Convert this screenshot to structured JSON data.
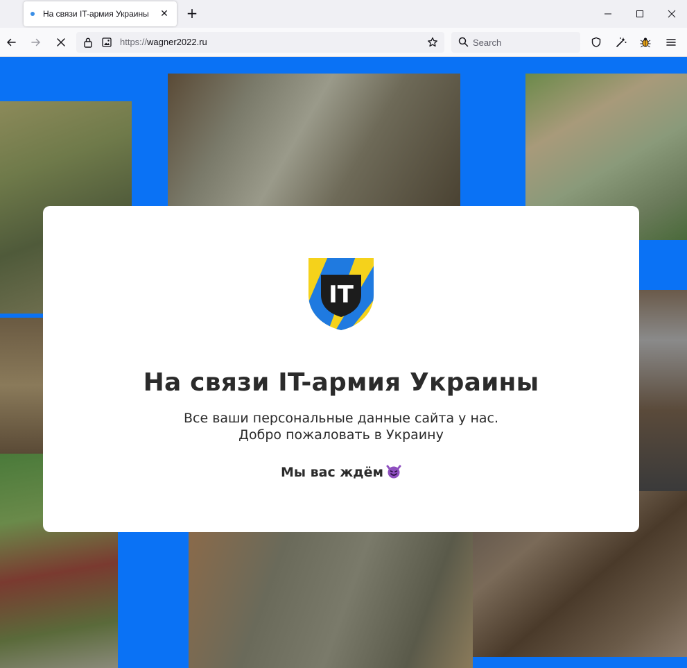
{
  "browser": {
    "tab_title": "На связи IT-армия Украины",
    "tab_close": "✕",
    "new_tab": "+",
    "url_scheme": "https://",
    "url_host": "wagner2022.ru",
    "search_placeholder": "Search"
  },
  "page": {
    "logo_text": "IT",
    "heading": "На связи IT-армия Украины",
    "subtext_line1": "Все ваши персональные данные сайта у нас.",
    "subtext_line2": "Добро пожаловать в Украину",
    "tagline": "Мы вас ждём"
  },
  "icons": {
    "back": "arrow-left-icon",
    "forward": "arrow-right-icon",
    "stop": "close-icon",
    "lock": "lock-icon",
    "page_info": "image-icon",
    "bookmark": "star-icon",
    "search": "search-icon",
    "shield": "shield-icon",
    "extension": "wand-icon",
    "bug": "bug-icon",
    "menu": "hamburger-icon",
    "devil_emoji": "smiling-devil-icon"
  },
  "colors": {
    "page_background": "#0a72f5",
    "card": "#ffffff",
    "logo_blue": "#1f7ae0",
    "logo_yellow": "#f5d21b",
    "text": "#2b2b2b"
  }
}
